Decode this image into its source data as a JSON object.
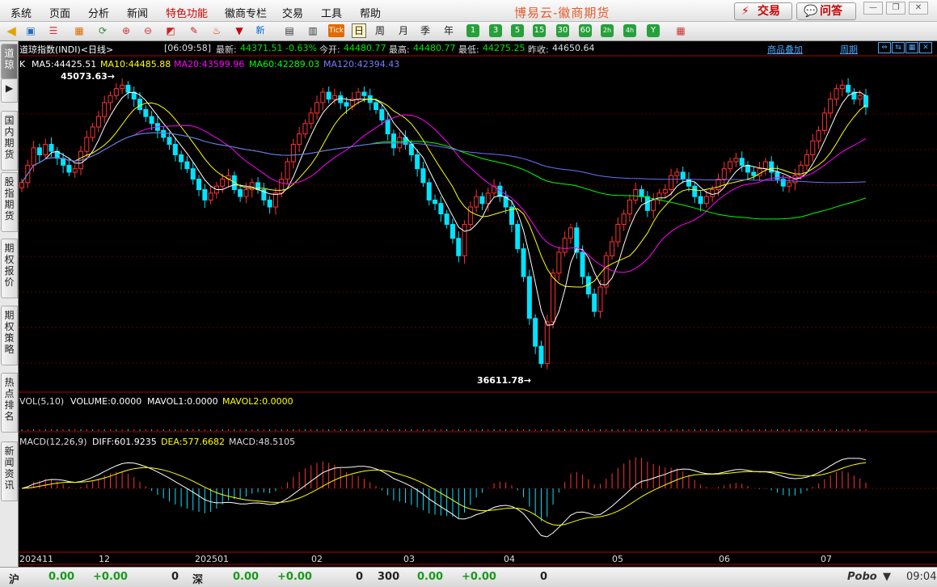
{
  "menu": {
    "items": [
      "系统",
      "页面",
      "分析",
      "新闻",
      "特色功能",
      "徽商专栏",
      "交易",
      "工具",
      "帮助"
    ],
    "app_title": "博易云-徽商期货",
    "trade_button": "交易",
    "ask_button": "问答",
    "win_min": "—",
    "win_restore": "❐",
    "win_close": "✕"
  },
  "toolbar": {
    "periods": [
      "日",
      "周",
      "月",
      "季",
      "年"
    ],
    "selected_period": "日",
    "minutes": [
      "1",
      "3",
      "5",
      "15",
      "30",
      "60"
    ],
    "hours": [
      "2h",
      "4h"
    ],
    "year_btn": "Y",
    "tick": "Tick",
    "new_icon": "新"
  },
  "left_tabs": [
    {
      "label": "道琼",
      "active": true
    },
    {
      "label": "▶",
      "active": false
    },
    {
      "label": "国内期货",
      "active": false
    },
    {
      "label": "股指期货",
      "active": false
    },
    {
      "label": "期权报价",
      "active": false
    },
    {
      "label": "期权策略",
      "active": false
    },
    {
      "label": "热点排名",
      "active": false
    },
    {
      "label": "新闻资讯",
      "active": false
    }
  ],
  "quote": {
    "name": "道琼指数(INDI)<日线>",
    "time": "[06:09:58]",
    "latest_label": "最新:",
    "latest": "44371.51",
    "change": "-0.63%",
    "open_label": "今开:",
    "open": "44480.77",
    "high_label": "最高:",
    "high": "44480.77",
    "low_label": "最低:",
    "low": "44275.25",
    "prev_label": "昨收:",
    "prev": "44650.64",
    "overlay_link": "商品叠加",
    "period_link": "周期"
  },
  "ma": {
    "k": "K",
    "ma5": "MA5:44425.51",
    "ma10": "MA10:44485.88",
    "ma20": "MA20:43599.96",
    "ma60": "MA60:42289.03",
    "ma120": "MA120:42394.43",
    "high_mark": "45073.63",
    "low_mark": "36611.78"
  },
  "vol": {
    "title": "VOL(5,10)",
    "volume": "VOLUME:0.0000",
    "mavol1": "MAVOL1:0.0000",
    "mavol2": "MAVOL2:0.0000"
  },
  "macd": {
    "title": "MACD(12,26,9)",
    "diff": "DIFF:601.9235",
    "dea": "DEA:577.6682",
    "macd": "MACD:48.5105"
  },
  "x_labels": [
    "202411",
    "12",
    "202501",
    "02",
    "03",
    "04",
    "05",
    "06",
    "07"
  ],
  "status": {
    "sh": "沪",
    "sh_v1": "0.00",
    "sh_v2": "+0.00",
    "sh_v3": "0",
    "sz": "深",
    "sz_v1": "0.00",
    "sz_v2": "+0.00",
    "sz_v3": "0",
    "i300": "300",
    "i300_v1": "0.00",
    "i300_v2": "+0.00",
    "i300_v3": "0",
    "brand": "Pobo",
    "time": "09:04"
  },
  "colors": {
    "up": "#ff3232",
    "down": "#00e4ff",
    "ma5": "#ffffff",
    "ma10": "#ffff00",
    "ma20": "#ff00ff",
    "ma60": "#00ff00",
    "ma120": "#6e6eff"
  },
  "chart_data": {
    "type": "candlestick",
    "title": "道琼指数(INDI)<日线>",
    "x_ticks": [
      "202411",
      "12",
      "202501",
      "02",
      "03",
      "04",
      "05",
      "06",
      "07"
    ],
    "marked_high": 45073.63,
    "marked_low": 36611.78,
    "closes": [
      42200,
      42700,
      43200,
      43000,
      43300,
      43100,
      42900,
      42700,
      42500,
      42600,
      43100,
      43500,
      43800,
      44100,
      44500,
      44700,
      44900,
      45000,
      44800,
      44600,
      44300,
      44100,
      43900,
      43700,
      43500,
      43300,
      43000,
      42800,
      42600,
      42300,
      42000,
      41700,
      41900,
      42100,
      42300,
      42400,
      42000,
      41800,
      42000,
      42200,
      42000,
      41700,
      41500,
      41900,
      42300,
      42800,
      43300,
      43600,
      43900,
      44200,
      44500,
      44800,
      44600,
      44700,
      44500,
      44400,
      44600,
      44800,
      44700,
      44500,
      44300,
      44000,
      43600,
      43200,
      43500,
      43300,
      43000,
      42600,
      42200,
      41700,
      41600,
      41300,
      41000,
      40600,
      40100,
      41000,
      41500,
      41800,
      41600,
      41900,
      42100,
      41800,
      41500,
      41000,
      40300,
      39500,
      38300,
      37500,
      37000,
      38200,
      39600,
      40200,
      40600,
      40900,
      40200,
      39500,
      39000,
      38500,
      39200,
      40100,
      40500,
      41000,
      41300,
      41700,
      42000,
      41800,
      41400,
      41700,
      41900,
      42000,
      42400,
      42500,
      42300,
      42100,
      41800,
      41600,
      41800,
      42000,
      42300,
      42600,
      42800,
      42900,
      42700,
      42500,
      42400,
      42600,
      42800,
      42500,
      42300,
      42100,
      42200,
      42400,
      42700,
      43000,
      43400,
      43700,
      44200,
      44600,
      44900,
      45000,
      44800,
      44600,
      44700,
      44371
    ]
  }
}
